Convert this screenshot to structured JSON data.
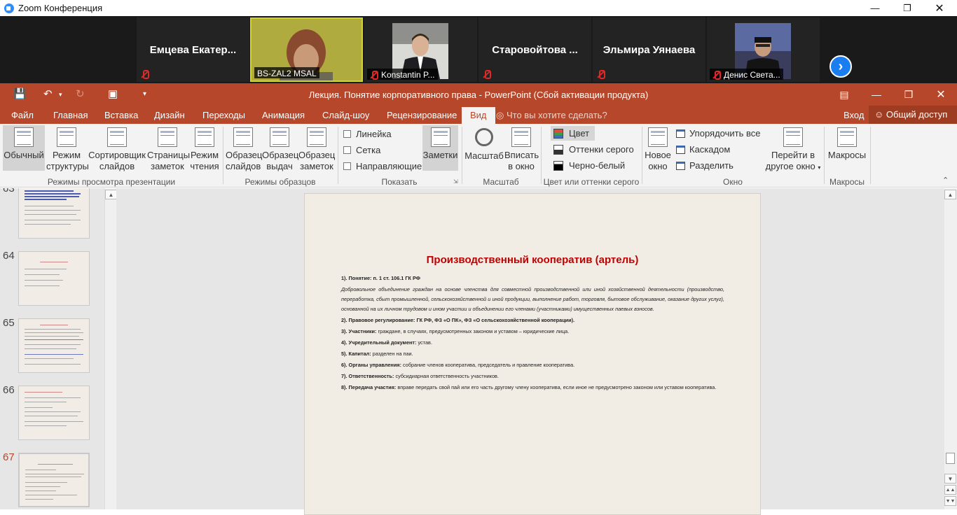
{
  "zoom": {
    "title": "Zoom Конференция",
    "participants": [
      {
        "name": "Емцева Екатер...",
        "label": "",
        "muted": true,
        "video": false
      },
      {
        "name": "",
        "label": "BS-ZAL2 MSAL",
        "muted": false,
        "video": true
      },
      {
        "name": "",
        "label": "Konstantin P...",
        "muted": true,
        "video": true
      },
      {
        "name": "Старовойтова ...",
        "label": "",
        "muted": true,
        "video": false
      },
      {
        "name": "Эльмира Уянаева",
        "label": "",
        "muted": true,
        "video": false
      },
      {
        "name": "",
        "label": "Денис Света...",
        "muted": true,
        "video": true
      }
    ],
    "next_icon": "›"
  },
  "ppt": {
    "doc_title": "Лекция. Понятие корпоративного права - PowerPoint (Сбой активации продукта)",
    "tabs": [
      "Файл",
      "Главная",
      "Вставка",
      "Дизайн",
      "Переходы",
      "Анимация",
      "Слайд-шоу",
      "Рецензирование",
      "Вид"
    ],
    "active_tab": "Вид",
    "tell_me": "Что вы хотите сделать?",
    "sign_in": "Вход",
    "share": "Общий доступ",
    "ribbon": {
      "normal": "Обычный",
      "outline_l1": "Режим",
      "outline_l2": "структуры",
      "sorter_l1": "Сортировщик",
      "sorter_l2": "слайдов",
      "notes_page_l1": "Страницы",
      "notes_page_l2": "заметок",
      "reading_l1": "Режим",
      "reading_l2": "чтения",
      "group_views": "Режимы просмотра презентации",
      "slide_master_l1": "Образец",
      "slide_master_l2": "слайдов",
      "handout_master_l1": "Образец",
      "handout_master_l2": "выдач",
      "notes_master_l1": "Образец",
      "notes_master_l2": "заметок",
      "group_masters": "Режимы образцов",
      "ruler": "Линейка",
      "grid": "Сетка",
      "guides": "Направляющие",
      "group_show": "Показать",
      "notes": "Заметки",
      "zoom": "Масштаб",
      "fit_l1": "Вписать",
      "fit_l2": "в окно",
      "group_zoom": "Масштаб",
      "color": "Цвет",
      "grayscale": "Оттенки серого",
      "bw": "Черно-белый",
      "group_color": "Цвет или оттенки серого",
      "new_window_l1": "Новое",
      "new_window_l2": "окно",
      "arrange_all": "Упорядочить все",
      "cascade": "Каскадом",
      "split": "Разделить",
      "switch_l1": "Перейти в",
      "switch_l2": "другое окно",
      "group_window": "Окно",
      "macros": "Макросы",
      "group_macros": "Макросы"
    },
    "thumb_numbers": [
      "63",
      "64",
      "65",
      "66",
      "67"
    ],
    "slide": {
      "title": "Производственный кооператив (артель)",
      "p1_b": "1). Понятие: п. 1 ст. 106.1 ГК РФ",
      "p1_i": "Добровольное объединение граждан на основе членства для совместной производственной или иной хозяйственной деятельности (производство, переработка, сбыт промышленной, сельскохозяйственной и иной продукции, выполнение работ, торговля, бытовое обслуживание, оказание других услуг), основанной на их личном трудовом и ином участии и объединении его членами (участниками) имущественных паевых взносов.",
      "p2_b": "2). Правовое регулирование: ГК РФ, ФЗ «О ПК», ФЗ «О сельскохозяйственной кооперации).",
      "p3_b": "3). Участники:",
      "p3_t": " граждане, в случаях, предусмотренных законом и уставом – юридические лица.",
      "p4_b": "4). Учредительный документ:",
      "p4_t": " устав.",
      "p5_b": "5). Капитал:",
      "p5_t": " разделен на паи.",
      "p6_b": "6). Органы управления:",
      "p6_t": " собрание членов кооператива, председатель и правление кооператива.",
      "p7_b": "7). Ответственность:",
      "p7_t": " субсидиарная ответственность участников.",
      "p8_b": "8). Передача участия:",
      "p8_t": " вправе передать свой пай или его часть другому члену кооператива, если иное не предусмотрено законом или уставом кооператива."
    }
  }
}
